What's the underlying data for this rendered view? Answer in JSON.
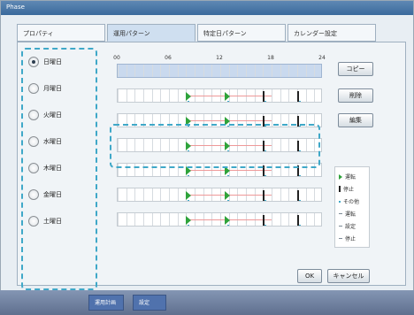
{
  "window": {
    "title": "Phase"
  },
  "tabs": [
    {
      "label": "プロパティ"
    },
    {
      "label": "運用パターン"
    },
    {
      "label": "特定日パターン"
    },
    {
      "label": "カレンダー設定"
    }
  ],
  "days": [
    {
      "label": "日曜日",
      "checked": true
    },
    {
      "label": "月曜日",
      "checked": false
    },
    {
      "label": "火曜日",
      "checked": false
    },
    {
      "label": "水曜日",
      "checked": false
    },
    {
      "label": "木曜日",
      "checked": false
    },
    {
      "label": "金曜日",
      "checked": false
    },
    {
      "label": "土曜日",
      "checked": false
    }
  ],
  "axis": {
    "ticks": [
      "00",
      "06",
      "12",
      "18",
      "24"
    ]
  },
  "buttons": {
    "copy": "コピー",
    "delete": "削除",
    "edit": "編集",
    "ok": "OK",
    "cancel": "キャンセル"
  },
  "legend": {
    "run": "運転",
    "stop": "停止",
    "other": "その他",
    "run2": "運転",
    "setting": "設定",
    "stop2": "停止"
  },
  "taskbar": {
    "item1": "運用計画",
    "item2": "設定"
  }
}
